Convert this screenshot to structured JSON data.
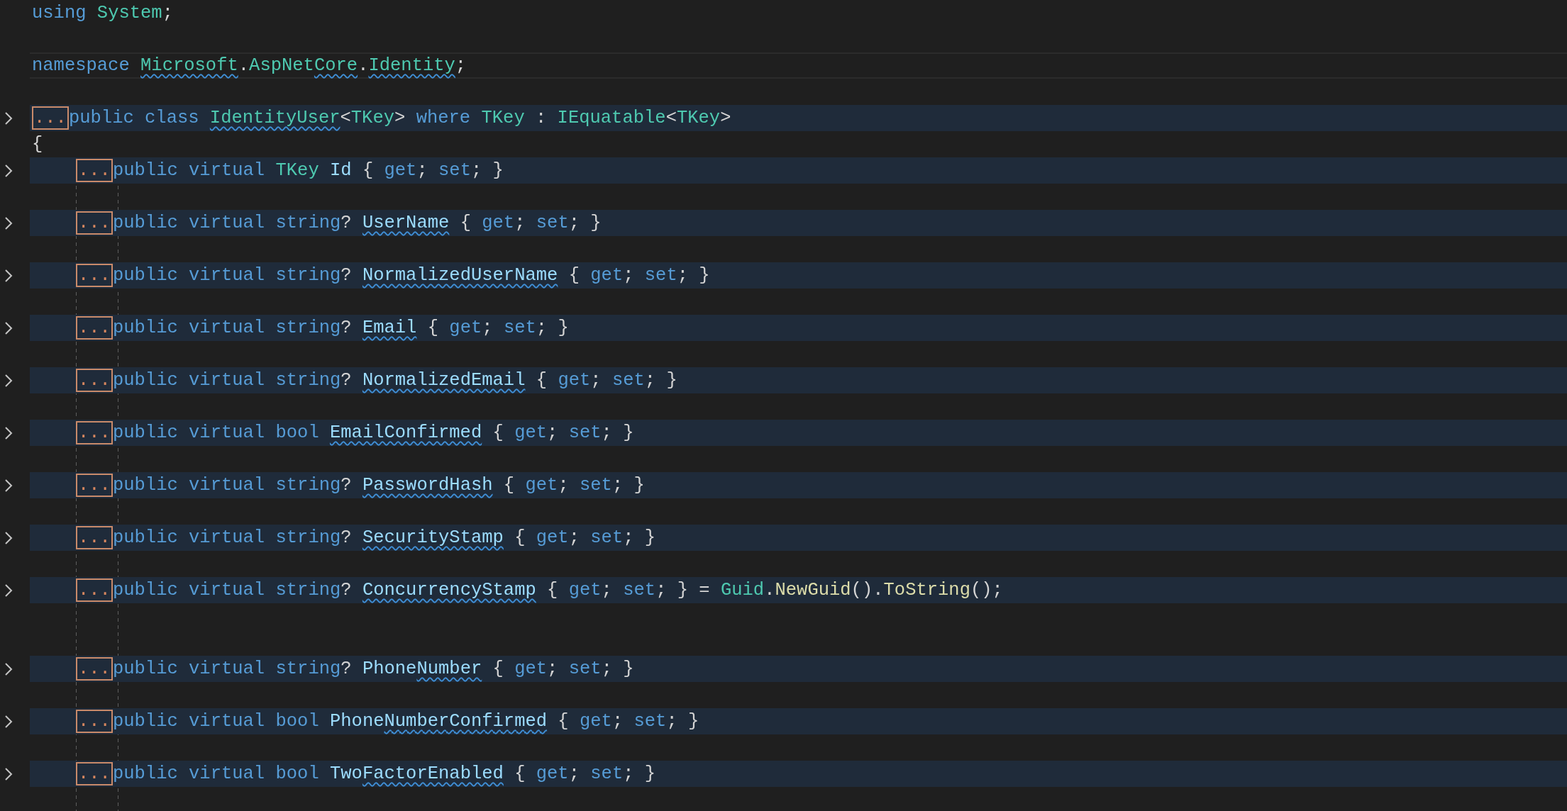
{
  "lines": [
    {
      "kind": "code",
      "folded": false,
      "current": false,
      "tokens": [
        {
          "text": "using ",
          "kind": "keyword",
          "squiggle": false
        },
        {
          "text": "System",
          "kind": "type",
          "squiggle": false
        },
        {
          "text": ";",
          "kind": "punct",
          "squiggle": false
        }
      ]
    },
    {
      "kind": "blank"
    },
    {
      "kind": "code",
      "folded": false,
      "current": true,
      "tokens": [
        {
          "text": "namespace ",
          "kind": "keyword",
          "squiggle": false
        },
        {
          "text": "Microsoft",
          "kind": "type",
          "squiggle": true
        },
        {
          "text": ".",
          "kind": "punct",
          "squiggle": false
        },
        {
          "text": "AspNet",
          "kind": "type",
          "squiggle": false
        },
        {
          "text": "Core",
          "kind": "type",
          "squiggle": true
        },
        {
          "text": ".",
          "kind": "punct",
          "squiggle": false
        },
        {
          "text": "Identity",
          "kind": "type",
          "squiggle": true
        },
        {
          "text": ";",
          "kind": "punct",
          "squiggle": false
        }
      ]
    },
    {
      "kind": "blank"
    },
    {
      "kind": "code",
      "folded": true,
      "fold_text": "...",
      "current": false,
      "tokens": [
        {
          "text": "public class ",
          "kind": "keyword",
          "squiggle": false
        },
        {
          "text": "IdentityUser",
          "kind": "type",
          "squiggle": true
        },
        {
          "text": "<",
          "kind": "punct",
          "squiggle": false
        },
        {
          "text": "TKey",
          "kind": "type",
          "squiggle": false
        },
        {
          "text": "> ",
          "kind": "punct",
          "squiggle": false
        },
        {
          "text": "where ",
          "kind": "keyword",
          "squiggle": false
        },
        {
          "text": "TKey",
          "kind": "type",
          "squiggle": false
        },
        {
          "text": " : ",
          "kind": "punct",
          "squiggle": false
        },
        {
          "text": "IEquatable",
          "kind": "type",
          "squiggle": false
        },
        {
          "text": "<",
          "kind": "punct",
          "squiggle": false
        },
        {
          "text": "TKey",
          "kind": "type",
          "squiggle": false
        },
        {
          "text": ">",
          "kind": "punct",
          "squiggle": false
        }
      ]
    },
    {
      "kind": "code",
      "folded": false,
      "current": false,
      "tokens": [
        {
          "text": "{",
          "kind": "punct",
          "squiggle": false
        }
      ]
    }
  ],
  "body": [
    {
      "kind": "code",
      "folded": true,
      "fold_text": "...",
      "current": false,
      "tokens": [
        {
          "text": "public virtual ",
          "kind": "keyword",
          "squiggle": false
        },
        {
          "text": "TKey ",
          "kind": "type",
          "squiggle": false
        },
        {
          "text": "Id",
          "kind": "property",
          "squiggle": false
        },
        {
          "text": " { ",
          "kind": "punct",
          "squiggle": false
        },
        {
          "text": "get",
          "kind": "keyword",
          "squiggle": false
        },
        {
          "text": "; ",
          "kind": "punct",
          "squiggle": false
        },
        {
          "text": "set",
          "kind": "keyword",
          "squiggle": false
        },
        {
          "text": "; }",
          "kind": "punct",
          "squiggle": false
        }
      ]
    },
    {
      "kind": "blank"
    },
    {
      "kind": "code",
      "folded": true,
      "fold_text": "...",
      "current": false,
      "tokens": [
        {
          "text": "public virtual ",
          "kind": "keyword",
          "squiggle": false
        },
        {
          "text": "string",
          "kind": "keyword",
          "squiggle": false
        },
        {
          "text": "? ",
          "kind": "punct",
          "squiggle": false
        },
        {
          "text": "UserName",
          "kind": "property",
          "squiggle": true
        },
        {
          "text": " { ",
          "kind": "punct",
          "squiggle": false
        },
        {
          "text": "get",
          "kind": "keyword",
          "squiggle": false
        },
        {
          "text": "; ",
          "kind": "punct",
          "squiggle": false
        },
        {
          "text": "set",
          "kind": "keyword",
          "squiggle": false
        },
        {
          "text": "; }",
          "kind": "punct",
          "squiggle": false
        }
      ]
    },
    {
      "kind": "blank"
    },
    {
      "kind": "code",
      "folded": true,
      "fold_text": "...",
      "current": false,
      "tokens": [
        {
          "text": "public virtual ",
          "kind": "keyword",
          "squiggle": false
        },
        {
          "text": "string",
          "kind": "keyword",
          "squiggle": false
        },
        {
          "text": "? ",
          "kind": "punct",
          "squiggle": false
        },
        {
          "text": "NormalizedUserName",
          "kind": "property",
          "squiggle": true
        },
        {
          "text": " { ",
          "kind": "punct",
          "squiggle": false
        },
        {
          "text": "get",
          "kind": "keyword",
          "squiggle": false
        },
        {
          "text": "; ",
          "kind": "punct",
          "squiggle": false
        },
        {
          "text": "set",
          "kind": "keyword",
          "squiggle": false
        },
        {
          "text": "; }",
          "kind": "punct",
          "squiggle": false
        }
      ]
    },
    {
      "kind": "blank"
    },
    {
      "kind": "code",
      "folded": true,
      "fold_text": "...",
      "current": false,
      "tokens": [
        {
          "text": "public virtual ",
          "kind": "keyword",
          "squiggle": false
        },
        {
          "text": "string",
          "kind": "keyword",
          "squiggle": false
        },
        {
          "text": "? ",
          "kind": "punct",
          "squiggle": false
        },
        {
          "text": "Email",
          "kind": "property",
          "squiggle": true
        },
        {
          "text": " { ",
          "kind": "punct",
          "squiggle": false
        },
        {
          "text": "get",
          "kind": "keyword",
          "squiggle": false
        },
        {
          "text": "; ",
          "kind": "punct",
          "squiggle": false
        },
        {
          "text": "set",
          "kind": "keyword",
          "squiggle": false
        },
        {
          "text": "; }",
          "kind": "punct",
          "squiggle": false
        }
      ]
    },
    {
      "kind": "blank"
    },
    {
      "kind": "code",
      "folded": true,
      "fold_text": "...",
      "current": false,
      "tokens": [
        {
          "text": "public virtual ",
          "kind": "keyword",
          "squiggle": false
        },
        {
          "text": "string",
          "kind": "keyword",
          "squiggle": false
        },
        {
          "text": "? ",
          "kind": "punct",
          "squiggle": false
        },
        {
          "text": "NormalizedEmail",
          "kind": "property",
          "squiggle": true
        },
        {
          "text": " { ",
          "kind": "punct",
          "squiggle": false
        },
        {
          "text": "get",
          "kind": "keyword",
          "squiggle": false
        },
        {
          "text": "; ",
          "kind": "punct",
          "squiggle": false
        },
        {
          "text": "set",
          "kind": "keyword",
          "squiggle": false
        },
        {
          "text": "; }",
          "kind": "punct",
          "squiggle": false
        }
      ]
    },
    {
      "kind": "blank"
    },
    {
      "kind": "code",
      "folded": true,
      "fold_text": "...",
      "current": false,
      "tokens": [
        {
          "text": "public virtual ",
          "kind": "keyword",
          "squiggle": false
        },
        {
          "text": "bool ",
          "kind": "keyword",
          "squiggle": false
        },
        {
          "text": "EmailConfirmed",
          "kind": "property",
          "squiggle": true
        },
        {
          "text": " { ",
          "kind": "punct",
          "squiggle": false
        },
        {
          "text": "get",
          "kind": "keyword",
          "squiggle": false
        },
        {
          "text": "; ",
          "kind": "punct",
          "squiggle": false
        },
        {
          "text": "set",
          "kind": "keyword",
          "squiggle": false
        },
        {
          "text": "; }",
          "kind": "punct",
          "squiggle": false
        }
      ]
    },
    {
      "kind": "blank"
    },
    {
      "kind": "code",
      "folded": true,
      "fold_text": "...",
      "current": false,
      "tokens": [
        {
          "text": "public virtual ",
          "kind": "keyword",
          "squiggle": false
        },
        {
          "text": "string",
          "kind": "keyword",
          "squiggle": false
        },
        {
          "text": "? ",
          "kind": "punct",
          "squiggle": false
        },
        {
          "text": "PasswordHash",
          "kind": "property",
          "squiggle": true
        },
        {
          "text": " { ",
          "kind": "punct",
          "squiggle": false
        },
        {
          "text": "get",
          "kind": "keyword",
          "squiggle": false
        },
        {
          "text": "; ",
          "kind": "punct",
          "squiggle": false
        },
        {
          "text": "set",
          "kind": "keyword",
          "squiggle": false
        },
        {
          "text": "; }",
          "kind": "punct",
          "squiggle": false
        }
      ]
    },
    {
      "kind": "blank"
    },
    {
      "kind": "code",
      "folded": true,
      "fold_text": "...",
      "current": false,
      "tokens": [
        {
          "text": "public virtual ",
          "kind": "keyword",
          "squiggle": false
        },
        {
          "text": "string",
          "kind": "keyword",
          "squiggle": false
        },
        {
          "text": "? ",
          "kind": "punct",
          "squiggle": false
        },
        {
          "text": "SecurityStamp",
          "kind": "property",
          "squiggle": true
        },
        {
          "text": " { ",
          "kind": "punct",
          "squiggle": false
        },
        {
          "text": "get",
          "kind": "keyword",
          "squiggle": false
        },
        {
          "text": "; ",
          "kind": "punct",
          "squiggle": false
        },
        {
          "text": "set",
          "kind": "keyword",
          "squiggle": false
        },
        {
          "text": "; }",
          "kind": "punct",
          "squiggle": false
        }
      ]
    },
    {
      "kind": "blank"
    },
    {
      "kind": "code",
      "folded": true,
      "fold_text": "...",
      "current": false,
      "tokens": [
        {
          "text": "public virtual ",
          "kind": "keyword",
          "squiggle": false
        },
        {
          "text": "string",
          "kind": "keyword",
          "squiggle": false
        },
        {
          "text": "? ",
          "kind": "punct",
          "squiggle": false
        },
        {
          "text": "ConcurrencyStamp",
          "kind": "property",
          "squiggle": true
        },
        {
          "text": " { ",
          "kind": "punct",
          "squiggle": false
        },
        {
          "text": "get",
          "kind": "keyword",
          "squiggle": false
        },
        {
          "text": "; ",
          "kind": "punct",
          "squiggle": false
        },
        {
          "text": "set",
          "kind": "keyword",
          "squiggle": false
        },
        {
          "text": "; } = ",
          "kind": "punct",
          "squiggle": false
        },
        {
          "text": "Guid",
          "kind": "type",
          "squiggle": false
        },
        {
          "text": ".",
          "kind": "punct",
          "squiggle": false
        },
        {
          "text": "NewGuid",
          "kind": "method",
          "squiggle": false
        },
        {
          "text": "().",
          "kind": "punct",
          "squiggle": false
        },
        {
          "text": "ToString",
          "kind": "method",
          "squiggle": false
        },
        {
          "text": "();",
          "kind": "punct",
          "squiggle": false
        }
      ]
    },
    {
      "kind": "blank"
    },
    {
      "kind": "blank"
    },
    {
      "kind": "code",
      "folded": true,
      "fold_text": "...",
      "current": false,
      "tokens": [
        {
          "text": "public virtual ",
          "kind": "keyword",
          "squiggle": false
        },
        {
          "text": "string",
          "kind": "keyword",
          "squiggle": false
        },
        {
          "text": "? ",
          "kind": "punct",
          "squiggle": false
        },
        {
          "text": "Phone",
          "kind": "property",
          "squiggle": false
        },
        {
          "text": "Number",
          "kind": "property",
          "squiggle": true
        },
        {
          "text": " { ",
          "kind": "punct",
          "squiggle": false
        },
        {
          "text": "get",
          "kind": "keyword",
          "squiggle": false
        },
        {
          "text": "; ",
          "kind": "punct",
          "squiggle": false
        },
        {
          "text": "set",
          "kind": "keyword",
          "squiggle": false
        },
        {
          "text": "; }",
          "kind": "punct",
          "squiggle": false
        }
      ]
    },
    {
      "kind": "blank"
    },
    {
      "kind": "code",
      "folded": true,
      "fold_text": "...",
      "current": false,
      "tokens": [
        {
          "text": "public virtual ",
          "kind": "keyword",
          "squiggle": false
        },
        {
          "text": "bool ",
          "kind": "keyword",
          "squiggle": false
        },
        {
          "text": "Phone",
          "kind": "property",
          "squiggle": false
        },
        {
          "text": "NumberConfirmed",
          "kind": "property",
          "squiggle": true
        },
        {
          "text": " { ",
          "kind": "punct",
          "squiggle": false
        },
        {
          "text": "get",
          "kind": "keyword",
          "squiggle": false
        },
        {
          "text": "; ",
          "kind": "punct",
          "squiggle": false
        },
        {
          "text": "set",
          "kind": "keyword",
          "squiggle": false
        },
        {
          "text": "; }",
          "kind": "punct",
          "squiggle": false
        }
      ]
    },
    {
      "kind": "blank"
    },
    {
      "kind": "code",
      "folded": true,
      "fold_text": "...",
      "current": false,
      "tokens": [
        {
          "text": "public virtual ",
          "kind": "keyword",
          "squiggle": false
        },
        {
          "text": "bool ",
          "kind": "keyword",
          "squiggle": false
        },
        {
          "text": "Two",
          "kind": "property",
          "squiggle": false
        },
        {
          "text": "FactorEnabled",
          "kind": "property",
          "squiggle": true
        },
        {
          "text": " { ",
          "kind": "punct",
          "squiggle": false
        },
        {
          "text": "get",
          "kind": "keyword",
          "squiggle": false
        },
        {
          "text": "; ",
          "kind": "punct",
          "squiggle": false
        },
        {
          "text": "set",
          "kind": "keyword",
          "squiggle": false
        },
        {
          "text": "; }",
          "kind": "punct",
          "squiggle": false
        }
      ]
    },
    {
      "kind": "blank"
    }
  ]
}
